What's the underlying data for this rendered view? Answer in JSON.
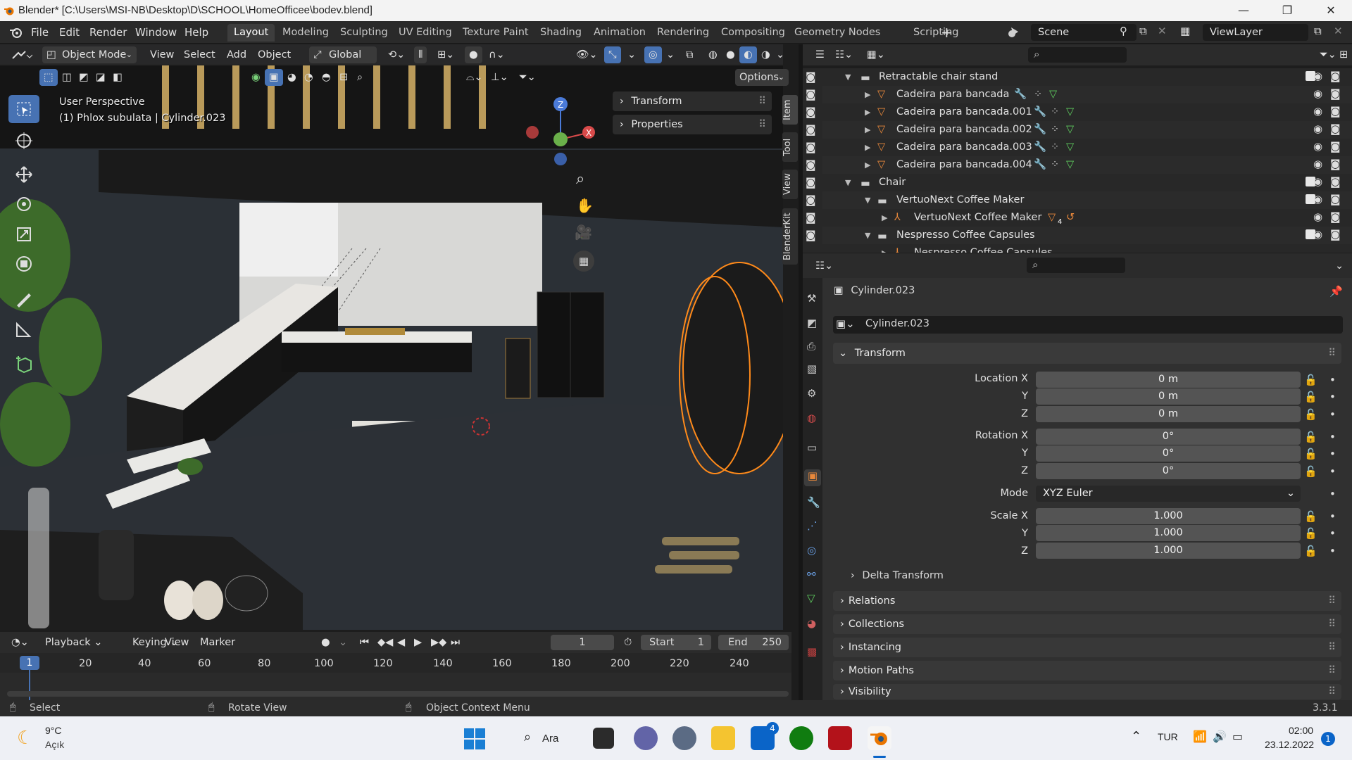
{
  "window": {
    "title": "Blender* [C:\\Users\\MSI-NB\\Desktop\\D\\SCHOOL\\HomeOfficee\\bodev.blend]",
    "minimize": "—",
    "maximize": "❐",
    "close": "✕"
  },
  "menu": [
    "File",
    "Edit",
    "Render",
    "Window",
    "Help"
  ],
  "workspaces": [
    "Layout",
    "Modeling",
    "Sculpting",
    "UV Editing",
    "Texture Paint",
    "Shading",
    "Animation",
    "Rendering",
    "Compositing",
    "Geometry Nodes",
    "Scripting"
  ],
  "active_workspace": "Layout",
  "scene_name": "Scene",
  "view_layer": "ViewLayer",
  "viewport": {
    "mode": "Object Mode",
    "header_menus": [
      "View",
      "Select",
      "Add",
      "Object"
    ],
    "transform_orientation": "Global",
    "options_label": "Options",
    "overlay_line1": "User Perspective",
    "overlay_line2": "(1) Phlox subulata | Cylinder.023",
    "npanel_items": [
      "Transform",
      "Properties"
    ],
    "sidetabs": [
      "Item",
      "Tool",
      "View",
      "BlenderKit"
    ],
    "gizmo_axes": [
      "X",
      "Y",
      "Z"
    ]
  },
  "outliner": {
    "rows": [
      {
        "label": "Retractable chair stand",
        "indent": 0,
        "arrow": "▼",
        "type": "collection",
        "checkbox": true
      },
      {
        "label": "Cadeira para bancada",
        "indent": 2,
        "arrow": "▶",
        "type": "mesh",
        "checkbox": false
      },
      {
        "label": "Cadeira para bancada.001",
        "indent": 2,
        "arrow": "▶",
        "type": "mesh",
        "checkbox": false
      },
      {
        "label": "Cadeira para bancada.002",
        "indent": 2,
        "arrow": "▶",
        "type": "mesh",
        "checkbox": false
      },
      {
        "label": "Cadeira para bancada.003",
        "indent": 2,
        "arrow": "▶",
        "type": "mesh",
        "checkbox": false
      },
      {
        "label": "Cadeira para bancada.004",
        "indent": 2,
        "arrow": "▶",
        "type": "mesh",
        "checkbox": false
      },
      {
        "label": "Chair",
        "indent": 0,
        "arrow": "▼",
        "type": "collection",
        "checkbox": true
      },
      {
        "label": "VertuoNext Coffee Maker",
        "indent": 1,
        "arrow": "▼",
        "type": "collection",
        "checkbox": true
      },
      {
        "label": "VertuoNext Coffee Maker",
        "indent": 2,
        "arrow": "▶",
        "type": "armature",
        "checkbox": false
      },
      {
        "label": "Nespresso Coffee Capsules",
        "indent": 1,
        "arrow": "▼",
        "type": "collection",
        "checkbox": true
      },
      {
        "label": "Nespresso Coffee Capsules",
        "indent": 2,
        "arrow": "▶",
        "type": "armature",
        "checkbox": false
      }
    ],
    "badge_count": "4"
  },
  "properties": {
    "object_name": "Cylinder.023",
    "datablock_name": "Cylinder.023",
    "transform_label": "Transform",
    "location_label": "Location X",
    "rotation_label": "Rotation X",
    "scale_label": "Scale X",
    "mode_label": "Mode",
    "y_label": "Y",
    "z_label": "Z",
    "location": [
      "0 m",
      "0 m",
      "0 m"
    ],
    "rotation": [
      "0°",
      "0°",
      "0°"
    ],
    "mode": "XYZ Euler",
    "scale": [
      "1.000",
      "1.000",
      "1.000"
    ],
    "delta_transform": "Delta Transform",
    "panels": [
      "Relations",
      "Collections",
      "Instancing",
      "Motion Paths",
      "Visibility"
    ]
  },
  "timeline": {
    "menus": [
      "Playback",
      "Keying",
      "View",
      "Marker"
    ],
    "current_frame": "1",
    "start_label": "Start",
    "start": "1",
    "end_label": "End",
    "end": "250",
    "ticks": [
      "20",
      "40",
      "60",
      "80",
      "100",
      "120",
      "140",
      "160",
      "180",
      "200",
      "220",
      "240"
    ],
    "playhead": "1"
  },
  "statusbar": {
    "select": "Select",
    "rotate": "Rotate View",
    "context": "Object Context Menu",
    "version": "3.3.1"
  },
  "taskbar": {
    "weather_temp": "9°C",
    "weather_desc": "Açık",
    "search_label": "Ara",
    "mail_badge": "4",
    "lang": "TUR",
    "time": "02:00",
    "date": "23.12.2022",
    "notif_count": "1"
  },
  "colors": {
    "accent": "#4772b3",
    "selection_orange": "#ff8a1a",
    "mesh_icon": "#e8883b",
    "data_green": "#5fcf5f",
    "wrench_blue": "#6aa0e6"
  }
}
